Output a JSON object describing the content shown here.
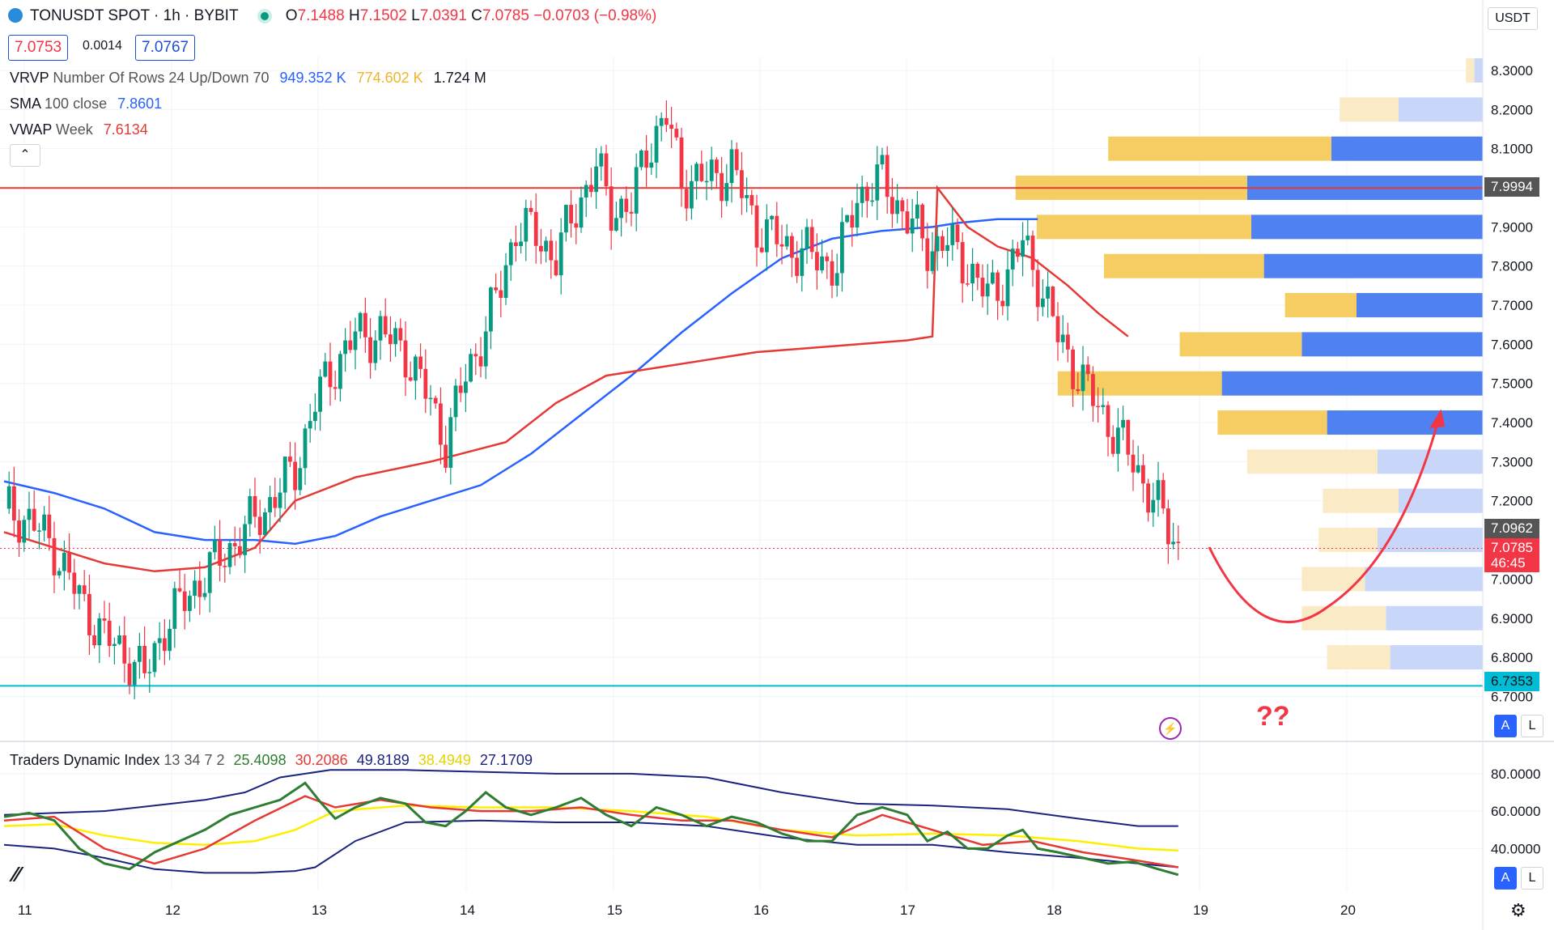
{
  "header": {
    "symbol": "TONUSDT SPOT · 1h · BYBIT",
    "open_label": "O",
    "open": "7.1488",
    "high_label": "H",
    "high": "7.1502",
    "low_label": "L",
    "low": "7.0391",
    "close_label": "C",
    "close": "7.0785",
    "change": "−0.0703 (−0.98%)",
    "bid": "7.0753",
    "spread": "0.0014",
    "ask": "7.0767",
    "currency": "USDT"
  },
  "indicators": {
    "vrvp_label": "VRVP",
    "vrvp_params": "Number Of Rows 24 Up/Down 70",
    "vrvp_up": "949.352 K",
    "vrvp_down": "774.602 K",
    "vrvp_total": "1.724 M",
    "sma_label": "SMA",
    "sma_params": "100 close",
    "sma_value": "7.8601",
    "vwap_label": "VWAP",
    "vwap_params": "Week",
    "vwap_value": "7.6134",
    "tdi_label": "Traders Dynamic Index",
    "tdi_params": "13 34 7 2",
    "tdi_v1": "25.4098",
    "tdi_v2": "30.2086",
    "tdi_v3": "49.8189",
    "tdi_v4": "38.4949",
    "tdi_v5": "27.1709"
  },
  "price_tags": {
    "resistance": "7.9994",
    "vwap_tag": "7.0962",
    "last": "7.0785",
    "countdown": "46:45",
    "support": "6.7353"
  },
  "annotation": {
    "text": "??"
  },
  "buttons": {
    "a": "A",
    "l": "L",
    "collapse": "⌃"
  },
  "colors": {
    "up": "#089981",
    "down": "#f23645",
    "sma": "#2962ff",
    "vwap": "#e53935",
    "resistance": "#e53935",
    "support": "#00bcd4",
    "tdi_green": "#2e7d32",
    "tdi_red": "#e53935",
    "tdi_yellow": "#ffee00",
    "tdi_band": "#1a237e"
  },
  "chart_data": {
    "type": "candlestick",
    "x_ticks": [
      "11",
      "12",
      "13",
      "14",
      "15",
      "16",
      "17",
      "18",
      "19",
      "20"
    ],
    "y_ticks": [
      "8.3000",
      "8.2000",
      "8.1000",
      "8.0000",
      "7.9000",
      "7.8000",
      "7.7000",
      "7.6000",
      "7.5000",
      "7.4000",
      "7.3000",
      "7.2000",
      "7.1000",
      "7.0000",
      "6.9000",
      "6.8000",
      "6.7000"
    ],
    "ylim": [
      6.67,
      8.34
    ],
    "close_path": [
      [
        0,
        7.18
      ],
      [
        5,
        7.15
      ],
      [
        10,
        7.08
      ],
      [
        15,
        6.95
      ],
      [
        20,
        6.85
      ],
      [
        25,
        6.8
      ],
      [
        28,
        6.75
      ],
      [
        32,
        6.88
      ],
      [
        38,
        6.98
      ],
      [
        45,
        7.08
      ],
      [
        52,
        7.18
      ],
      [
        58,
        7.28
      ],
      [
        62,
        7.45
      ],
      [
        66,
        7.55
      ],
      [
        70,
        7.62
      ],
      [
        75,
        7.63
      ],
      [
        80,
        7.58
      ],
      [
        85,
        7.45
      ],
      [
        88,
        7.35
      ],
      [
        92,
        7.52
      ],
      [
        96,
        7.64
      ],
      [
        99,
        7.75
      ],
      [
        102,
        7.9
      ],
      [
        106,
        7.88
      ],
      [
        110,
        7.82
      ],
      [
        114,
        7.95
      ],
      [
        118,
        8.05
      ],
      [
        121,
        7.95
      ],
      [
        125,
        7.95
      ],
      [
        128,
        8.1
      ],
      [
        132,
        8.18
      ],
      [
        135,
        8.02
      ],
      [
        140,
        8.02
      ],
      [
        145,
        8.05
      ],
      [
        150,
        7.9
      ],
      [
        156,
        7.85
      ],
      [
        162,
        7.82
      ],
      [
        166,
        7.8
      ],
      [
        170,
        7.98
      ],
      [
        175,
        8.02
      ],
      [
        180,
        7.92
      ],
      [
        184,
        7.85
      ],
      [
        188,
        7.86
      ],
      [
        192,
        7.8
      ],
      [
        196,
        7.72
      ],
      [
        200,
        7.78
      ],
      [
        203,
        7.86
      ],
      [
        206,
        7.77
      ],
      [
        210,
        7.62
      ],
      [
        215,
        7.5
      ],
      [
        220,
        7.4
      ],
      [
        225,
        7.3
      ],
      [
        230,
        7.18
      ],
      [
        234,
        7.08
      ]
    ],
    "sma100": [
      [
        0,
        7.25
      ],
      [
        10,
        7.22
      ],
      [
        20,
        7.18
      ],
      [
        30,
        7.12
      ],
      [
        40,
        7.1
      ],
      [
        50,
        7.1
      ],
      [
        58,
        7.09
      ],
      [
        66,
        7.11
      ],
      [
        75,
        7.16
      ],
      [
        85,
        7.2
      ],
      [
        95,
        7.24
      ],
      [
        105,
        7.32
      ],
      [
        115,
        7.42
      ],
      [
        125,
        7.52
      ],
      [
        135,
        7.63
      ],
      [
        145,
        7.73
      ],
      [
        155,
        7.82
      ],
      [
        165,
        7.87
      ],
      [
        175,
        7.89
      ],
      [
        185,
        7.9
      ],
      [
        190,
        7.91
      ],
      [
        198,
        7.92
      ],
      [
        206,
        7.92
      ]
    ],
    "vwap_week": [
      [
        0,
        7.12
      ],
      [
        10,
        7.08
      ],
      [
        20,
        7.04
      ],
      [
        30,
        7.02
      ],
      [
        40,
        7.03
      ],
      [
        50,
        7.08
      ],
      [
        58,
        7.2
      ],
      [
        70,
        7.26
      ],
      [
        85,
        7.3
      ],
      [
        100,
        7.35
      ],
      [
        110,
        7.45
      ],
      [
        120,
        7.52
      ],
      [
        130,
        7.54
      ],
      [
        140,
        7.56
      ],
      [
        150,
        7.58
      ],
      [
        160,
        7.59
      ],
      [
        170,
        7.6
      ],
      [
        180,
        7.61
      ],
      [
        185,
        7.62
      ],
      [
        186,
        8.0
      ],
      [
        192,
        7.9
      ],
      [
        198,
        7.85
      ],
      [
        205,
        7.82
      ],
      [
        212,
        7.75
      ],
      [
        218,
        7.68
      ],
      [
        224,
        7.62
      ]
    ],
    "volume_profile": [
      {
        "price": 8.1,
        "up": 0.53,
        "down": 0.36,
        "in_range": true
      },
      {
        "price": 8.0,
        "up": 0.55,
        "down": 0.56,
        "in_range": true
      },
      {
        "price": 7.9,
        "up": 0.51,
        "down": 0.55,
        "in_range": true
      },
      {
        "price": 7.8,
        "up": 0.38,
        "down": 0.52,
        "in_range": true
      },
      {
        "price": 7.7,
        "up": 0.17,
        "down": 0.3,
        "in_range": true
      },
      {
        "price": 7.6,
        "up": 0.29,
        "down": 0.43,
        "in_range": true
      },
      {
        "price": 7.5,
        "up": 0.39,
        "down": 0.62,
        "in_range": true
      },
      {
        "price": 7.4,
        "up": 0.26,
        "down": 0.37,
        "in_range": true
      },
      {
        "price": 7.3,
        "up": 0.31,
        "down": 0.25,
        "in_range": false
      },
      {
        "price": 7.2,
        "up": 0.18,
        "down": 0.2,
        "in_range": false
      },
      {
        "price": 7.1,
        "up": 0.14,
        "down": 0.25,
        "in_range": false
      },
      {
        "price": 7.0,
        "up": 0.15,
        "down": 0.28,
        "in_range": false
      },
      {
        "price": 6.9,
        "up": 0.2,
        "down": 0.23,
        "in_range": false
      },
      {
        "price": 6.8,
        "up": 0.15,
        "down": 0.22,
        "in_range": false
      },
      {
        "price": 8.2,
        "up": 0.14,
        "down": 0.2,
        "in_range": false
      },
      {
        "price": 8.3,
        "up": 0.02,
        "down": 0.02,
        "in_range": false
      }
    ],
    "tdi": {
      "y_ticks": [
        "80.0000",
        "60.0000",
        "40.0000"
      ],
      "ylim": [
        22,
        86
      ],
      "upper_band": [
        [
          0,
          58
        ],
        [
          10,
          59
        ],
        [
          20,
          60
        ],
        [
          30,
          63
        ],
        [
          40,
          66
        ],
        [
          48,
          70
        ],
        [
          55,
          78
        ],
        [
          65,
          82
        ],
        [
          80,
          82
        ],
        [
          95,
          81
        ],
        [
          110,
          80
        ],
        [
          125,
          80
        ],
        [
          140,
          78
        ],
        [
          155,
          70
        ],
        [
          170,
          64
        ],
        [
          185,
          63
        ],
        [
          200,
          61
        ],
        [
          214,
          56
        ],
        [
          226,
          52
        ],
        [
          234,
          52
        ]
      ],
      "lower_band": [
        [
          0,
          42
        ],
        [
          10,
          40
        ],
        [
          20,
          35
        ],
        [
          30,
          29
        ],
        [
          40,
          27
        ],
        [
          50,
          27
        ],
        [
          58,
          28
        ],
        [
          62,
          30
        ],
        [
          70,
          44
        ],
        [
          80,
          54
        ],
        [
          95,
          55
        ],
        [
          110,
          54
        ],
        [
          125,
          54
        ],
        [
          140,
          52
        ],
        [
          155,
          46
        ],
        [
          170,
          42
        ],
        [
          185,
          42
        ],
        [
          200,
          38
        ],
        [
          214,
          35
        ],
        [
          226,
          32
        ],
        [
          234,
          30
        ]
      ],
      "middle": [
        [
          0,
          52
        ],
        [
          10,
          53
        ],
        [
          20,
          47
        ],
        [
          30,
          43
        ],
        [
          40,
          42
        ],
        [
          50,
          44
        ],
        [
          58,
          50
        ],
        [
          66,
          60
        ],
        [
          80,
          63
        ],
        [
          95,
          62
        ],
        [
          110,
          62
        ],
        [
          125,
          60
        ],
        [
          140,
          57
        ],
        [
          155,
          50
        ],
        [
          170,
          47
        ],
        [
          185,
          48
        ],
        [
          200,
          47
        ],
        [
          214,
          44
        ],
        [
          226,
          40
        ],
        [
          234,
          39
        ]
      ],
      "price_line": [
        [
          0,
          57
        ],
        [
          5,
          59
        ],
        [
          10,
          55
        ],
        [
          15,
          40
        ],
        [
          20,
          32
        ],
        [
          25,
          29
        ],
        [
          30,
          38
        ],
        [
          35,
          44
        ],
        [
          40,
          50
        ],
        [
          45,
          58
        ],
        [
          50,
          62
        ],
        [
          55,
          66
        ],
        [
          60,
          75
        ],
        [
          63,
          65
        ],
        [
          66,
          56
        ],
        [
          70,
          62
        ],
        [
          75,
          67
        ],
        [
          80,
          64
        ],
        [
          84,
          54
        ],
        [
          88,
          52
        ],
        [
          92,
          60
        ],
        [
          96,
          70
        ],
        [
          100,
          62
        ],
        [
          105,
          58
        ],
        [
          110,
          62
        ],
        [
          115,
          67
        ],
        [
          120,
          58
        ],
        [
          125,
          52
        ],
        [
          130,
          62
        ],
        [
          135,
          58
        ],
        [
          140,
          52
        ],
        [
          145,
          57
        ],
        [
          150,
          54
        ],
        [
          155,
          48
        ],
        [
          160,
          44
        ],
        [
          165,
          44
        ],
        [
          170,
          58
        ],
        [
          175,
          62
        ],
        [
          180,
          58
        ],
        [
          184,
          44
        ],
        [
          188,
          49
        ],
        [
          192,
          40
        ],
        [
          196,
          40
        ],
        [
          200,
          47
        ],
        [
          203,
          50
        ],
        [
          206,
          40
        ],
        [
          210,
          38
        ],
        [
          215,
          35
        ],
        [
          220,
          32
        ],
        [
          225,
          33
        ],
        [
          230,
          29
        ],
        [
          234,
          26
        ]
      ],
      "signal_line": [
        [
          0,
          55
        ],
        [
          10,
          57
        ],
        [
          20,
          40
        ],
        [
          30,
          32
        ],
        [
          40,
          40
        ],
        [
          50,
          55
        ],
        [
          60,
          68
        ],
        [
          66,
          62
        ],
        [
          75,
          66
        ],
        [
          85,
          62
        ],
        [
          95,
          60
        ],
        [
          105,
          60
        ],
        [
          115,
          62
        ],
        [
          125,
          58
        ],
        [
          135,
          55
        ],
        [
          145,
          55
        ],
        [
          155,
          50
        ],
        [
          165,
          46
        ],
        [
          175,
          58
        ],
        [
          185,
          50
        ],
        [
          195,
          42
        ],
        [
          205,
          44
        ],
        [
          215,
          38
        ],
        [
          225,
          34
        ],
        [
          234,
          30
        ]
      ]
    }
  }
}
